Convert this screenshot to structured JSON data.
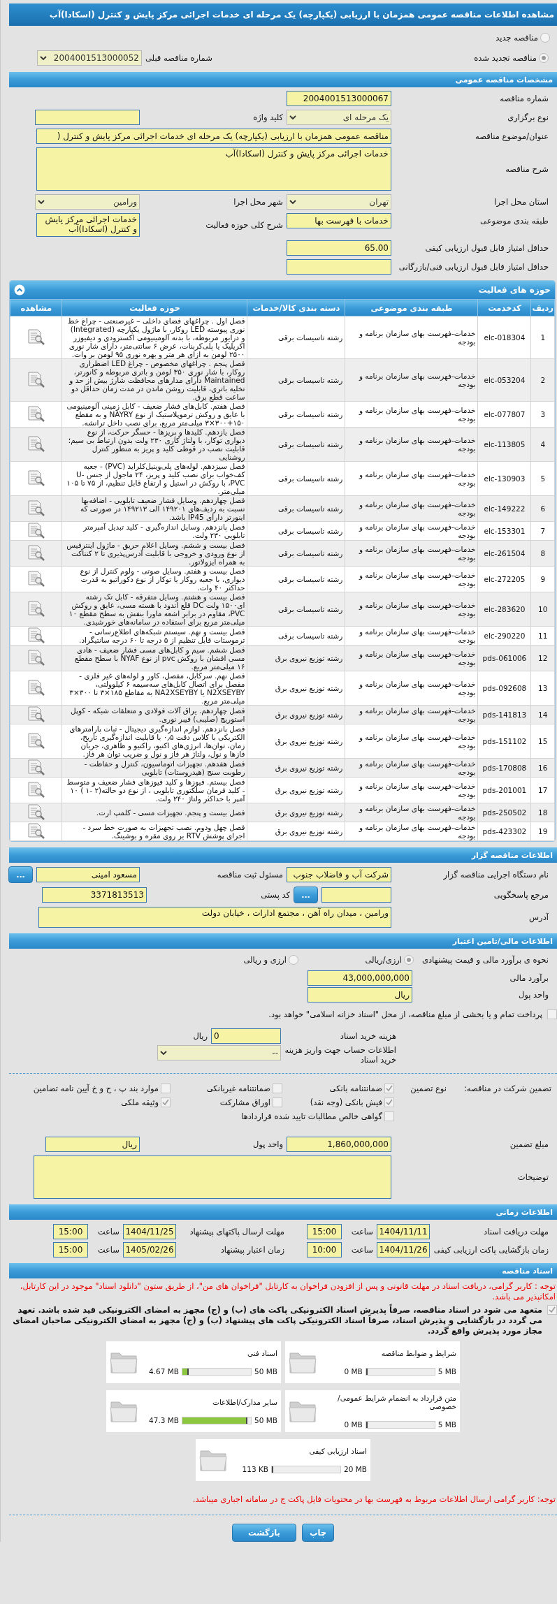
{
  "title": "مشاهده اطلاعات مناقصه عمومی همزمان با ارزیابی (یکپارچه) یک مرحله ای خدمات اجرائی مرکز پایش و کنترل (اسکادا)آب",
  "tender_type": [
    {
      "label": "مناقصه جدید",
      "selected": false
    },
    {
      "label": "مناقصه تجدید شده",
      "selected": true
    }
  ],
  "previous_number": {
    "label": "شماره مناقصه قبلی",
    "value": "2004001513000052"
  },
  "general": {
    "header": "مشخصات مناقصه عمومی",
    "rows": [
      [
        {
          "label": "شماره مناقصه",
          "value": "2004001513000067",
          "kind": "text"
        }
      ],
      [
        {
          "label": "نوع برگزاری",
          "value": "یک مرحله ای",
          "kind": "select"
        },
        {
          "label": "کلید واژه",
          "kind": "text"
        }
      ],
      [
        {
          "label": "عنوان/موضوع مناقصه",
          "value": "مناقصه عمومی همزمان با ارزیابی (یکپارچه) یک مرحله ای خدمات اجرائی مرکز پایش و کنترل (",
          "kind": "long_text"
        }
      ],
      [
        {
          "label": "شرح مناقصه",
          "value": "خدمات اجرائی مرکز پایش و کنترل (اسکادا)آب",
          "kind": "long_textarea"
        }
      ],
      [
        {
          "label": "استان محل اجرا",
          "value": "تهران",
          "kind": "select"
        },
        {
          "label": "شهر محل اجرا",
          "value": "ورامین",
          "kind": "select"
        }
      ],
      [
        {
          "label": "طبقه بندی موضوعی",
          "value": "خدمات با فهرست بها",
          "kind": "text"
        },
        {
          "label": "شرح کلی حوزه فعالیت",
          "value": "خدمات اجرائی مرکز پایش و کنترل (اسکادا)آب",
          "kind": "textarea"
        }
      ],
      [
        {
          "label": "حداقل امتیاز قابل قبول ارزیابی کیفی",
          "value": "65.00",
          "kind": "text"
        }
      ],
      [
        {
          "label": "حداقل امتیاز قابل قبول ارزیابی فنی/بازرگانی",
          "kind": "text"
        }
      ]
    ]
  },
  "activities": {
    "header": "حوزه های فعالیت",
    "columns": [
      "ردیف",
      "کدخدمت",
      "طبقه بندی موضوعی",
      "دسته بندی کالا/خدمات",
      "حوزه فعالیت",
      "مشاهده"
    ],
    "rows": [
      {
        "row": "1",
        "code": "elc-018304",
        "category": "خدمات-فهرست بهای سازمان برنامه و بودجه",
        "group": "رشته تاسیسات برقی",
        "activity": "فصل اول . چراغهای فضای داخلی – غیرصنعتی - چراغ خط نوری پیوسته LED روکار، با ماژول یکپارچه (Integrated) و درایور مربوطه، با بدنه آلومینیومی اکسترودی و دیفیوزر اکریلیک یا پلی‌کربنات، عرض ۶ سانتی‌متر، دارای شار نوری ۲۵۰۰ لومن به ازای هر متر و بهره نوری ۹۵ لومن بر وات."
      },
      {
        "row": "2",
        "code": "elc-053204",
        "category": "خدمات-فهرست بهای سازمان برنامه و بودجه",
        "group": "رشته تاسیسات برقی",
        "activity": "فصل پنجم . چراغهای مخصوص - چراغ LED اضطراری روکار، با شار نوری ۳۵۰ لومن و باتری مربوطه و کانورتر، Maintained دارای مدارهای محافظت شارژ بیش از حد و تخلیه باتری، قابلیت روشن ماندن در مدت زمان حداقل دو ساعت قطع برق."
      },
      {
        "row": "3",
        "code": "elc-077807",
        "category": "خدمات-فهرست بهای سازمان برنامه و بودجه",
        "group": "رشته تاسیسات برقی",
        "activity": "فصل هفتم. کابل‌های فشار ضعیف - کابل زمینی آلومینیومی با عایق و روکش ترموپلاستیک از نوع NAYRY و به مقطع ۱۵۰+۳۰۰×۳ میلی‌متر مربع، برای نصب داخل ترانشه."
      },
      {
        "row": "4",
        "code": "elc-113805",
        "category": "خدمات-فهرست بهای سازمان برنامه و بودجه",
        "group": "رشته تاسیسات برقی",
        "activity": "فصل یازدهم. کلیدها و پریزها - حسگر حرکت، از نوع دیواری توکار، با ولتاژ کاری ۲۳۰ ولت بدون ارتباط بی سیم؛ قابلیت نصب در قوطی کلید و پریز به منظور کنترل روشنایی"
      },
      {
        "row": "5",
        "code": "elc-130903",
        "category": "خدمات-فهرست بهای سازمان برنامه و بودجه",
        "group": "رشته تاسیسات برقی",
        "activity": "فصل سیزدهم. لوله‌های پلی‌وینیل‌کلراید (PVC) - جعبه کف‌خواب برای نصب کلید و پریز، ۲۴ ماجول از جنس U-PVC، با روکش در استیل و ارتفاع قابل تنظیم، از ۷۵ تا ۱۰۵ میلی‌متر."
      },
      {
        "row": "6",
        "code": "elc-149222",
        "category": "خدمات-فهرست بهای سازمان برنامه و بودجه",
        "group": "رشته تاسیسات برقی",
        "activity": "فصل چهاردهم. وسایل فشار ضعیف تابلویی - اضافه‌بها نسبت به ردیف‌های ۱۴۹۲۰۱ الی ۱۴۹۲۱۳ در صورتی که اینورتر دارای IP45 باشد."
      },
      {
        "row": "7",
        "code": "elc-153301",
        "category": "خدمات-فهرست بهای سازمان برنامه و بودجه",
        "group": "رشته تاسیسات برقی",
        "activity": "فصل پانزدهم. وسایل اندازه‌گیری - کلید تبدیل آمپرمتر تابلویی ۲۳۰ ولت."
      },
      {
        "row": "8",
        "code": "elc-261504",
        "category": "خدمات-فهرست بهای سازمان برنامه و بودجه",
        "group": "رشته تاسیسات برقی",
        "activity": "فصل بیست و ششم. وسایل اعلام حریق - ماژول اینترفیس از نوع ورودی و خروجی با قابلیت آدرس‌پذیری تا ۲ کنتاکت به همراه ایزولاتور."
      },
      {
        "row": "9",
        "code": "elc-272205",
        "category": "خدمات-فهرست بهای سازمان برنامه و بودجه",
        "group": "رشته تاسیسات برقی",
        "activity": "فصل بیست و هفتم. وسایل صوتی - ولوم کنترل از نوع دیواری، با جعبه روکار یا توکار از نوع دکوراتیو به قدرت حداکثر ۴۰ وات."
      },
      {
        "row": "10",
        "code": "elc-283620",
        "category": "خدمات-فهرست بهای سازمان برنامه و بودجه",
        "group": "رشته تاسیسات برقی",
        "activity": "فصل بیست و هشتم. وسایل متفرقه - کابل تک رشته ای۱۵۰۰ ولت DC قلع اندود با هسته مسی، عایق و روکش PVC، مقاوم در برابر اشعه ماورا بنفش به سطح مقطع ۱۰ میلی‌متر مربع برای استفاده در سامانه‌های خورشیدی."
      },
      {
        "row": "11",
        "code": "elc-290220",
        "category": "خدمات-فهرست بهای سازمان برنامه و بودجه",
        "group": "رشته تاسیسات برقی",
        "activity": "فصل بیست و نهم. سیستم شبکه‌های اطلاع‌رسانی - ترموستات قابل تنظیم از ۵ درجه تا ۶۰ درجه سانتیگراد."
      },
      {
        "row": "12",
        "code": "pds-061006",
        "category": "خدمات-فهرست بهای سازمان برنامه و بودجه",
        "group": "رشته توزیع نیروی برق",
        "activity": "فصل ششم. سیم و کابل‌های مسی فشار ضعیف - هادی مسی افشان با روکش pvc از نوع NYAF با سطح مقطع ۱۶ میلی‌متر مربع."
      },
      {
        "row": "13",
        "code": "pds-092608",
        "category": "خدمات-فهرست بهای سازمان برنامه و بودجه",
        "group": "رشته توزیع نیروی برق",
        "activity": "فصل نهم. سرکابل، مفصل، کاور و لوله‌های غیر فلزی - مفصل برای اتصال کابل‌های سه‌سیمه ۶ کیلوولتی، N2XSEYBY یا NA2XSEYBY به مقاطع ۱۸۵×۳ تا ۳۰۰×۳ میلی‌متر مربع."
      },
      {
        "row": "14",
        "code": "pds-141813",
        "category": "خدمات-فهرست بهای سازمان برنامه و بودجه",
        "group": "رشته توزیع نیروی برق",
        "activity": "فصل چهاردهم. یراق آلات فولادی و متعلقات شبکه - کوپل استوریج (صلیبی) فیبر نوری."
      },
      {
        "row": "15",
        "code": "pds-151102",
        "category": "خدمات-فهرست بهای سازمان برنامه و بودجه",
        "group": "رشته توزیع نیروی برق",
        "activity": "فصل پانزدهم. لوازم اندازه‌گیری دیجیتال - ثبات پارامترهای الکتریکی با کلاس دقت ۰٫۵ با قابلیت اندازه‌گیری تاریخ، زمان، توان‌ها، انرژی‌های اکتیو، راکتیو و ظاهری، جریان فازها و نول، ولتاژ هر فاز و نول و ضریب توان هر فاز."
      },
      {
        "row": "16",
        "code": "pds-170808",
        "category": "خدمات-فهرست بهای سازمان برنامه و بودجه",
        "group": "رشته توزیع نیروی برق",
        "activity": "فصل هفدهم. تجهیزات اتوماسیون، کنترل و حفاظت - رطوبت سنج (هیدروستات) تابلویی"
      },
      {
        "row": "17",
        "code": "pds-201001",
        "category": "خدمات-فهرست بهای سازمان برنامه و بودجه",
        "group": "رشته توزیع نیروی برق",
        "activity": "فصل بیستم. فیوزها و کلید فیوزهای فشار ضعیف و متوسط - کلید فرمان سلکتوری تابلویی ، از نوع دو حالته(۲ -۱ ) ۱۰ آمپر با حداکثر ولتاژ ۲۴۰ ولت."
      },
      {
        "row": "18",
        "code": "pds-250502",
        "category": "خدمات-فهرست بهای سازمان برنامه و بودجه",
        "group": "رشته توزیع نیروی برق",
        "activity": "فصل بیست و پنجم. تجهیزات مسی - کلمپ ارت."
      },
      {
        "row": "19",
        "code": "pds-423302",
        "category": "خدمات-فهرست بهای سازمان برنامه و بودجه",
        "group": "رشته توزیع نیروی برق",
        "activity": "فصل چهل ودوم. نصب تجهیزات به صورت خط سرد - اجرای پوشش RTV بر روی مقره و بوشینگ."
      }
    ]
  },
  "organizer": {
    "header": "اطلاعات مناقصه گزار",
    "agency": {
      "label": "نام دستگاه اجرایی مناقصه گزار",
      "value": "شرکت آب و فاضلاب جنوب"
    },
    "registrar": {
      "label": "مسئول ثبت مناقصه",
      "value": "مسعود امینی",
      "button": "..."
    },
    "responder": {
      "label": "مرجع پاسخگویی",
      "button": "..."
    },
    "postal_code": {
      "label": "کد پستی",
      "value": "3371813513"
    },
    "address": {
      "label": "آدرس",
      "value": "ورامین ، میدان راه آهن ، مجتمع ادارات ، خیابان دولت"
    }
  },
  "finance": {
    "header": "اطلاعات مالی/تامین اعتبار",
    "method": {
      "label": "نحوه ی برآورد مالی و قیمت پیشنهادی",
      "options": [
        {
          "label": "ارزی/ریالی",
          "selected": true
        },
        {
          "label": "ارزی و ریالی",
          "selected": false
        }
      ]
    },
    "estimate": {
      "label": "برآورد مالی",
      "value": "43,000,000,000"
    },
    "currency": {
      "label": "واحد پول",
      "value": "ریال"
    },
    "treasury": {
      "text": "پرداخت تمام و یا بخشی از مبلغ مناقصه، از محل \"اسناد خزانه اسلامی\" خواهد بود.",
      "checked": false
    },
    "doc_fee": {
      "label": "هزینه خرید اسناد",
      "value": "0",
      "unit": "ریال"
    },
    "account": {
      "label": "اطلاعات حساب جهت واریز هزینه خرید اسناد",
      "value": "--"
    }
  },
  "guarantee": {
    "label": "تضمین شرکت در مناقصه:",
    "type_label": "نوع تضمین",
    "options": [
      {
        "label": "ضمانتنامه بانکی",
        "checked": true
      },
      {
        "label": "ضمانتنامه غیربانکی",
        "checked": false
      },
      {
        "label": "موارد بند پ ، ح و خ آیین نامه تضامین",
        "checked": false
      },
      {
        "label": "فیش بانکی (وجه نقد)",
        "checked": true
      },
      {
        "label": "اوراق مشارکت",
        "checked": false
      },
      {
        "label": "وثیقه ملکی",
        "checked": true
      },
      {
        "label": "گواهی خالص مطالبات تایید شده قراردادها",
        "checked": false
      }
    ],
    "amount": {
      "label": "مبلغ تضمین",
      "value": "1,860,000,000"
    },
    "currency": {
      "label": "واحد پول",
      "value": "ریال"
    },
    "notes": {
      "label": "توضیحات"
    }
  },
  "timing": {
    "header": "اطلاعات زمانی",
    "items": [
      {
        "label": "مهلت دریافت اسناد",
        "date": "1404/11/11",
        "time_label": "ساعت",
        "time": "15:00"
      },
      {
        "label": "مهلت ارسال پاکتهای پیشنهاد",
        "date": "1404/11/25",
        "time_label": "ساعت",
        "time": "15:00"
      },
      {
        "label": "زمان بازگشایی پاکت ارزیابی کیفی",
        "date": "1404/11/26",
        "time_label": "ساعت",
        "time": "10:00"
      },
      {
        "label": "زمان اعتبار پیشنهاد",
        "date": "1405/02/26",
        "time_label": "ساعت",
        "time": "15:00"
      }
    ]
  },
  "documents": {
    "header": "اسناد مناقصه",
    "notice": "توجه : کاربر گرامی، دریافت اسناد در مهلت قانونی و پس از افزودن فراخوان به کارتابل \"فراخوان های من\"، از طریق ستون \"دانلود اسناد\" موجود در این کارتابل، امکانپذیر می باشد.",
    "commitment": {
      "text": "متعهد می شود در اسناد مناقصه، صرفاً پذیرش اسناد الکترونیکی پاکت های (ب) و (ج) مجهز به امضای الکترونیکی قید شده باشد. تعهد می گردد در بازگشایی و پذیرش اسناد، صرفاً اسناد الکترونیکی پاکت های پیشنهاد (ب) و (ج) مجهز به امضای الکترونیکی صاحبان امضای مجاز مورد پذیرش واقع گردد.",
      "checked": true
    },
    "files": [
      {
        "name": "شرایط و ضوابط مناقصه",
        "max": "5 MB",
        "used": "0 MB",
        "level": 0
      },
      {
        "name": "اسناد فنی",
        "max": "50 MB",
        "used": "4.67 MB",
        "level": 0.093
      },
      {
        "name": "متن قرارداد به انضمام شرایط عمومی/خصوصی",
        "max": "5 MB",
        "used": "0 MB",
        "level": 0
      },
      {
        "name": "سایر مدارک/اطلاعات",
        "max": "50 MB",
        "used": "47.3 MB",
        "level": 0.946
      },
      {
        "name": "اسناد ارزیابی کیفی",
        "max": "20 MB",
        "used": "113 KB",
        "level": 0.006
      }
    ],
    "footnote": "توجه: کاربر گرامی ارسال اطلاعات مربوط به فهرست بها در محتویات فایل پاکت ج در سامانه اجباری میباشد."
  },
  "buttons": [
    "چاپ",
    "بازگشت"
  ]
}
